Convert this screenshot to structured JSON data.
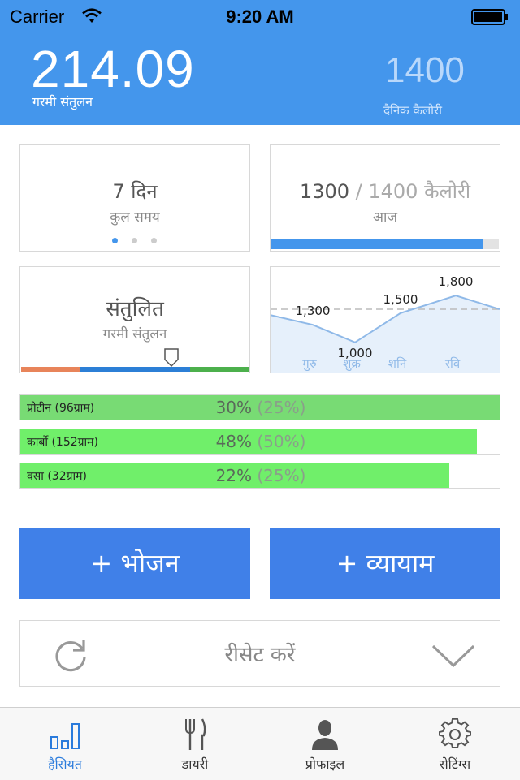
{
  "status_bar": {
    "carrier": "Carrier",
    "time": "9:20 AM"
  },
  "header": {
    "heat_balance_value": "214.09",
    "heat_balance_label": "गरमी संतुलन",
    "daily_calories_value": "1400",
    "daily_calories_label": "दैनिक कैलोरी"
  },
  "cards": {
    "time": {
      "title": "7 दिन",
      "subtitle": "कुल समय",
      "page_dots": 3,
      "active_dot": 0
    },
    "calories": {
      "consumed": "1300",
      "separator": " / ",
      "target": "1400 कैलोरी",
      "subtitle": "आज",
      "progress": 0.93
    },
    "balance": {
      "title": "संतुलित",
      "subtitle": "गरमी संतुलन",
      "marker_position": 0.66
    }
  },
  "chart_data": {
    "type": "area",
    "categories": [
      "गुरु",
      "शुक्र",
      "शनि",
      "रवि"
    ],
    "values": [
      1300,
      1000,
      1500,
      1800
    ],
    "data_labels": [
      "1,300",
      "1,000",
      "1,500",
      "1,800"
    ],
    "target_line": 1400,
    "ylim": [
      0,
      3000
    ],
    "grid": false,
    "colors": {
      "line": "#8fb9e8",
      "fill": "#e6f0fb",
      "target": "#bbbbbb"
    }
  },
  "macros": [
    {
      "label": "प्रोटीन (96ग्राम)",
      "percent": "30%",
      "target": "(25%)",
      "fill": 1.0
    },
    {
      "label": "कार्बो (152ग्राम)",
      "percent": "48%",
      "target": "(50%)",
      "fill": 0.952
    },
    {
      "label": "वसा (32ग्राम)",
      "percent": "22%",
      "target": "(25%)",
      "fill": 0.895
    }
  ],
  "actions": {
    "meal_button": "+ भोजन",
    "exercise_button": "+ व्यायाम"
  },
  "reset": {
    "label": "रीसेट करें"
  },
  "tabs": [
    {
      "label": "हैसियत",
      "icon": "bar-chart-icon",
      "active": true
    },
    {
      "label": "डायरी",
      "icon": "fork-knife-icon",
      "active": false
    },
    {
      "label": "प्रोफाइल",
      "icon": "person-icon",
      "active": false
    },
    {
      "label": "सेटिंग्स",
      "icon": "gear-icon",
      "active": false
    }
  ],
  "colors": {
    "header": "#4496ec",
    "accent": "#4080e8",
    "progress": "#4496ec",
    "balance_left": "#e8845a",
    "balance_mid": "#2c7fd6",
    "balance_right": "#4cb04c",
    "macro_fill": "#78db74",
    "macro_fill_light": "#70ef6a"
  }
}
